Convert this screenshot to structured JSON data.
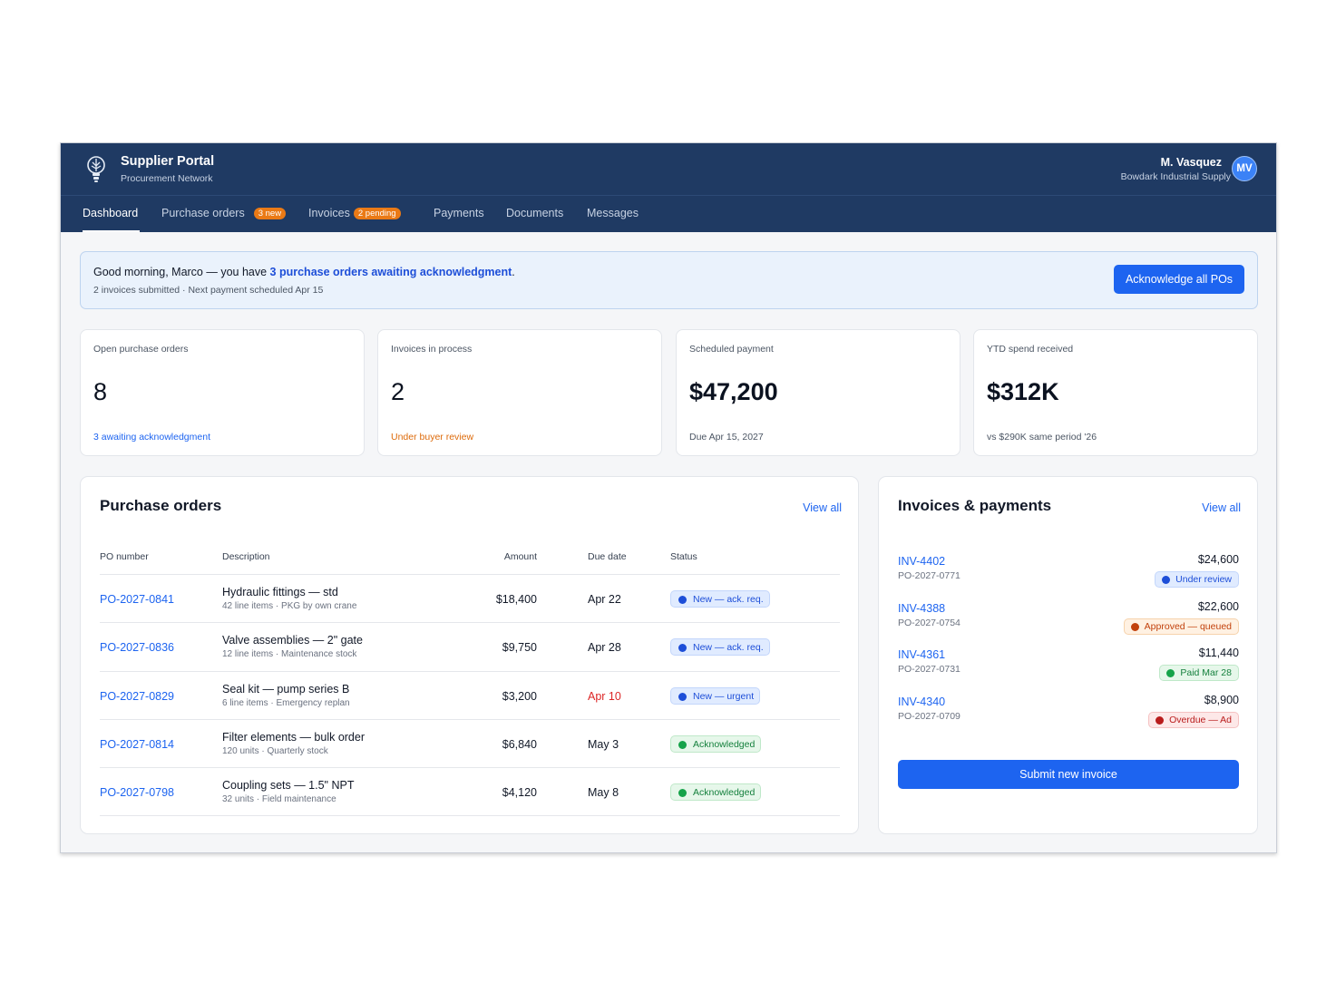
{
  "app": {
    "title": "Supplier Portal",
    "subtitle": "Procurement Network"
  },
  "user": {
    "name": "M. Vasquez",
    "org": "Bowdark Industrial Supply",
    "initials": "MV"
  },
  "nav": {
    "dashboard": "Dashboard",
    "purchase_orders": "Purchase orders",
    "purchase_orders_badge": "3 new",
    "invoices": "Invoices",
    "invoices_badge": "2 pending",
    "payments": "Payments",
    "documents": "Documents",
    "messages": "Messages"
  },
  "banner": {
    "greeting": "Good morning, Marco — you have ",
    "link": "3 purchase orders awaiting acknowledgment",
    "end": ".",
    "sub": "2 invoices submitted · Next payment scheduled Apr 15",
    "button": "Acknowledge all POs"
  },
  "kpis": [
    {
      "label": "Open purchase orders",
      "value": "8",
      "foot": "3 awaiting acknowledgment"
    },
    {
      "label": "Invoices in process",
      "value": "2",
      "foot": "Under buyer review"
    },
    {
      "label": "Scheduled payment",
      "value": "$47,200",
      "foot": "Due Apr 15, 2027"
    },
    {
      "label": "YTD spend received",
      "value": "$312K",
      "foot": "vs $290K same period '26"
    }
  ],
  "po_panel": {
    "title": "Purchase orders",
    "view_all": "View all",
    "columns": {
      "po": "PO number",
      "desc": "Description",
      "amount": "Amount",
      "due": "Due date",
      "status": "Status"
    },
    "rows": [
      {
        "po": "PO-2027-0841",
        "desc": "Hydraulic fittings — std",
        "sub": "42 line items · PKG by own crane",
        "amount": "$18,400",
        "due": "Apr 22",
        "status": "New — ack. req."
      },
      {
        "po": "PO-2027-0836",
        "desc": "Valve assemblies — 2\" gate",
        "sub": "12 line items · Maintenance stock",
        "amount": "$9,750",
        "due": "Apr 28",
        "status": "New — ack. req."
      },
      {
        "po": "PO-2027-0829",
        "desc": "Seal kit — pump series B",
        "sub": "6 line items · Emergency replan",
        "amount": "$3,200",
        "due": "Apr 10",
        "status": "New — urgent"
      },
      {
        "po": "PO-2027-0814",
        "desc": "Filter elements — bulk order",
        "sub": "120 units · Quarterly stock",
        "amount": "$6,840",
        "due": "May 3",
        "status": "Acknowledged"
      },
      {
        "po": "PO-2027-0798",
        "desc": "Coupling sets — 1.5\" NPT",
        "sub": "32 units · Field maintenance",
        "amount": "$4,120",
        "due": "May 8",
        "status": "Acknowledged"
      }
    ]
  },
  "inv_panel": {
    "title": "Invoices & payments",
    "view_all": "View all",
    "rows": [
      {
        "inv": "INV-4402",
        "po": "PO-2027-0771",
        "amount": "$24,600",
        "status": "Under review"
      },
      {
        "inv": "INV-4388",
        "po": "PO-2027-0754",
        "amount": "$22,600",
        "status": "Approved — queued"
      },
      {
        "inv": "INV-4361",
        "po": "PO-2027-0731",
        "amount": "$11,440",
        "status": "Paid Mar 28"
      },
      {
        "inv": "INV-4340",
        "po": "PO-2027-0709",
        "amount": "$8,900",
        "status": "Overdue — Ad"
      }
    ],
    "submit": "Submit new invoice"
  },
  "colors": {
    "header_bg": "#1f3a63",
    "accent": "#1d64f0",
    "badge_orange": "#ea7a16",
    "status_blue": "#1d4ed8",
    "status_green": "#16a34a",
    "status_orange": "#c2410c",
    "status_red": "#b91c1c",
    "due_overdue": "#dc2626"
  },
  "icons": {
    "logo": "tree-lightbulb-icon"
  }
}
